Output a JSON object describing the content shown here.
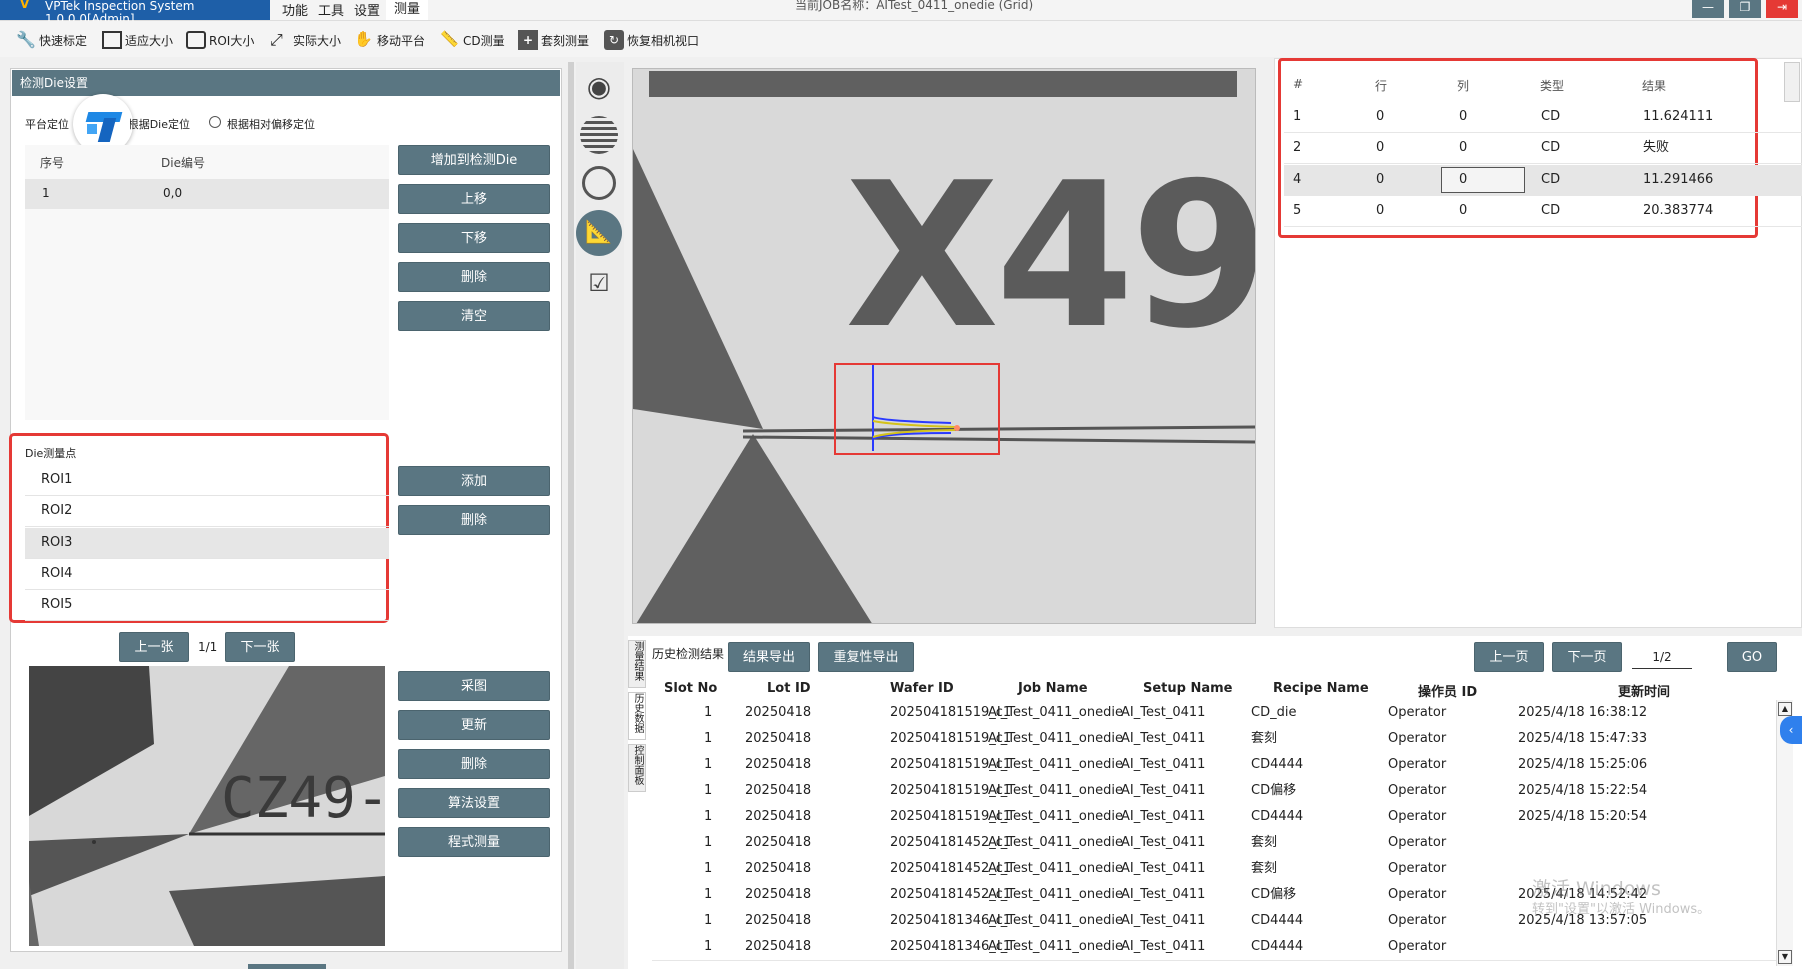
{
  "titlebar": {
    "app": "VPTek Inspection System 1.0.0.0[Admin]",
    "menus": [
      "功能",
      "工具",
      "设置",
      "测量"
    ],
    "job": "当前JOB名称：AITest_0411_onedie (Grid)"
  },
  "toolbar": [
    "快速标定",
    "适应大小",
    "ROI大小",
    "实际大小",
    "移动平台",
    "CD测量",
    "套刻测量",
    "恢复相机视口"
  ],
  "left": {
    "panel_title": "检测Die设置",
    "loc_label": "平台定位",
    "radio_die": "根据Die定位",
    "radio_offset": "根据相对偏移定位",
    "table_headers": [
      "序号",
      "Die编号"
    ],
    "rows": [
      {
        "no": "1",
        "die": "0,0"
      }
    ],
    "buttons": [
      "增加到检测Die",
      "上移",
      "下移",
      "删除",
      "清空"
    ],
    "points_title": "Die测量点",
    "points": [
      "ROI1",
      "ROI2",
      "ROI3",
      "ROI4",
      "ROI5"
    ],
    "point_buttons": [
      "添加",
      "删除"
    ],
    "prev": "上一张",
    "page": "1/1",
    "next": "下一张",
    "image_buttons": [
      "采图",
      "更新",
      "删除",
      "算法设置",
      "程式测量"
    ],
    "thumb_text": "CZ49-"
  },
  "viewer": {
    "label": "X49"
  },
  "results": {
    "headers": [
      "#",
      "行",
      "列",
      "类型",
      "结果"
    ],
    "rows": [
      {
        "n": "1",
        "row": "0",
        "col": "0",
        "type": "CD",
        "result": "11.624111"
      },
      {
        "n": "2",
        "row": "0",
        "col": "0",
        "type": "CD",
        "result": "失败"
      },
      {
        "n": "4",
        "row": "0",
        "col": "0",
        "type": "CD",
        "result": "11.291466"
      },
      {
        "n": "5",
        "row": "0",
        "col": "0",
        "type": "CD",
        "result": "20.383774"
      }
    ]
  },
  "history": {
    "side_tabs": [
      "测量结果",
      "历史数据",
      "控制面板"
    ],
    "title": "历史检测结果",
    "export": "结果导出",
    "repeat_export": "重复性导出",
    "prev": "上一页",
    "next": "下一页",
    "page": "1/2",
    "go": "GO",
    "headers": [
      "Slot No",
      "Lot ID",
      "Wafer ID",
      "Job Name",
      "Setup Name",
      "Recipe Name",
      "操作员 ID",
      "更新时间"
    ],
    "rows": [
      [
        "1",
        "20250418",
        "202504181519_c1",
        "AI_Test_0411_onedie",
        "AI_Test_0411",
        "CD_die",
        "Operator",
        "2025/4/18 16:38:12"
      ],
      [
        "1",
        "20250418",
        "202504181519_c1",
        "AI_Test_0411_onedie",
        "AI_Test_0411",
        "套刻",
        "Operator",
        "2025/4/18 15:47:33"
      ],
      [
        "1",
        "20250418",
        "202504181519_c1",
        "AI_Test_0411_onedie",
        "AI_Test_0411",
        "CD4444",
        "Operator",
        "2025/4/18 15:25:06"
      ],
      [
        "1",
        "20250418",
        "202504181519_c1",
        "AI_Test_0411_onedie",
        "AI_Test_0411",
        "CD偏移",
        "Operator",
        "2025/4/18 15:22:54"
      ],
      [
        "1",
        "20250418",
        "202504181519_c1",
        "AI_Test_0411_onedie",
        "AI_Test_0411",
        "CD4444",
        "Operator",
        "2025/4/18 15:20:54"
      ],
      [
        "1",
        "20250418",
        "202504181452_c1",
        "AI_Test_0411_onedie",
        "AI_Test_0411",
        "套刻",
        "Operator",
        ""
      ],
      [
        "1",
        "20250418",
        "202504181452_c1",
        "AI_Test_0411_onedie",
        "AI_Test_0411",
        "套刻",
        "Operator",
        ""
      ],
      [
        "1",
        "20250418",
        "202504181452_c1",
        "AI_Test_0411_onedie",
        "AI_Test_0411",
        "CD偏移",
        "Operator",
        "2025/4/18 14:52:42"
      ],
      [
        "1",
        "20250418",
        "202504181346_c1",
        "AI_Test_0411_onedie",
        "AI_Test_0411",
        "CD4444",
        "Operator",
        "2025/4/18 13:57:05"
      ],
      [
        "1",
        "20250418",
        "202504181346_c1",
        "AI_Test_0411_onedie",
        "AI_Test_0411",
        "CD4444",
        "Operator",
        ""
      ]
    ]
  },
  "watermark": {
    "line1": "激活 Windows",
    "line2": "转到\"设置\"以激活 Windows。"
  },
  "colors": {
    "button": "#5a7682",
    "highlight": "#e53935",
    "titlebar": "#1e5fa8"
  }
}
